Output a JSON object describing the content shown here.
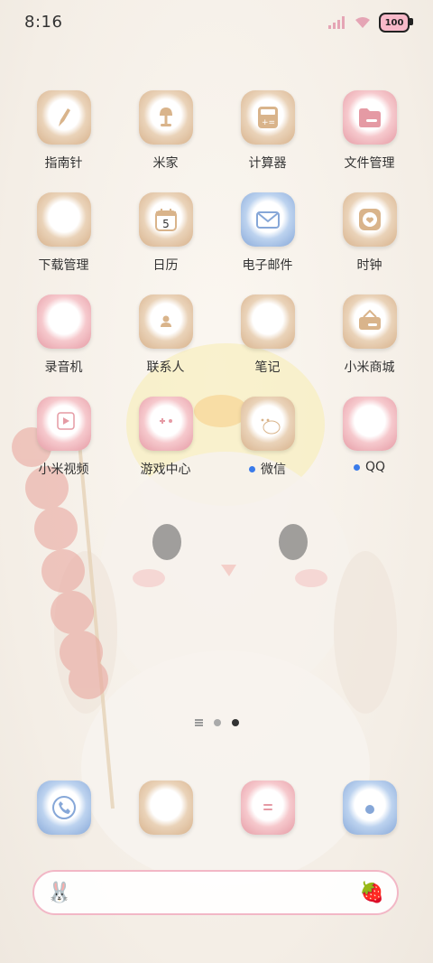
{
  "status_bar": {
    "time": "8:16",
    "battery_level": "100"
  },
  "apps": [
    {
      "name": "compass",
      "label": "指南针",
      "color": "beige",
      "icon": "compass-icon",
      "dot": false
    },
    {
      "name": "mi-home",
      "label": "米家",
      "color": "beige",
      "icon": "lamp-icon",
      "dot": false
    },
    {
      "name": "calculator",
      "label": "计算器",
      "color": "beige",
      "icon": "calculator-icon",
      "dot": false
    },
    {
      "name": "file-manager",
      "label": "文件管理",
      "color": "pink",
      "icon": "folder-icon",
      "dot": false
    },
    {
      "name": "downloads",
      "label": "下载管理",
      "color": "beige",
      "icon": "cloud-icon",
      "dot": false
    },
    {
      "name": "calendar",
      "label": "日历",
      "color": "beige",
      "icon": "calendar-icon",
      "dot": false,
      "badge_text": "5"
    },
    {
      "name": "email",
      "label": "电子邮件",
      "color": "blue",
      "icon": "mail-icon",
      "dot": false
    },
    {
      "name": "clock",
      "label": "时钟",
      "color": "beige",
      "icon": "clock-icon",
      "dot": false
    },
    {
      "name": "recorder",
      "label": "录音机",
      "color": "pink",
      "icon": "microphone-icon",
      "dot": false
    },
    {
      "name": "contacts",
      "label": "联系人",
      "color": "beige",
      "icon": "contacts-icon",
      "dot": false
    },
    {
      "name": "notes",
      "label": "笔记",
      "color": "beige",
      "icon": "notes-icon",
      "dot": false
    },
    {
      "name": "mi-store",
      "label": "小米商城",
      "color": "beige",
      "icon": "basket-icon",
      "dot": false
    },
    {
      "name": "mi-video",
      "label": "小米视频",
      "color": "pink",
      "icon": "video-icon",
      "dot": false
    },
    {
      "name": "game-center",
      "label": "游戏中心",
      "color": "pink",
      "icon": "gamepad-icon",
      "dot": false
    },
    {
      "name": "wechat",
      "label": "微信",
      "color": "beige",
      "icon": "wechat-icon",
      "dot": true
    },
    {
      "name": "qq",
      "label": "QQ",
      "color": "pink",
      "icon": "qq-penguin-icon",
      "dot": true
    }
  ],
  "dock": [
    {
      "name": "phone",
      "color": "blue",
      "icon": "phone-icon"
    },
    {
      "name": "browser",
      "color": "beige",
      "icon": "planet-icon"
    },
    {
      "name": "messages",
      "color": "pink",
      "icon": "message-icon"
    },
    {
      "name": "camera",
      "color": "blue",
      "icon": "camera-icon"
    }
  ],
  "search_bar": {
    "left_icon": "🐰",
    "right_icon": "🍓"
  },
  "colors": {
    "accent_pink": "#f2b7c6",
    "dot_blue": "#3a7bea"
  }
}
